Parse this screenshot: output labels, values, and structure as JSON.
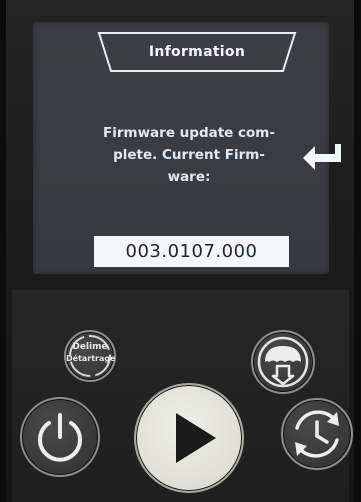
{
  "screen": {
    "title": "Information",
    "message_lines": [
      "Firmware update com-",
      "plete. Current Firm-",
      "ware:"
    ],
    "version": "003.0107.000"
  },
  "buttons": {
    "descale": {
      "label_en": "Delime",
      "label_fr": "Détartrage"
    }
  },
  "colors": {
    "screen_background": "#3a3c41",
    "screen_text": "#dce9f8",
    "version_background": "#f4f6f8",
    "play_button": "#e0dfd8"
  },
  "icons": [
    "enter-icon",
    "rinse-icon",
    "power-icon",
    "play-icon",
    "clock-icon"
  ]
}
